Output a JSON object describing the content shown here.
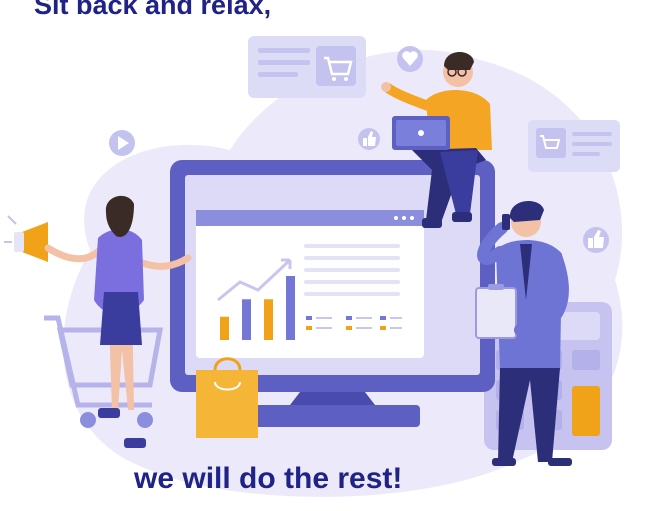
{
  "headline_top": "Sit back and relax,",
  "headline_bottom": "we will do the rest!",
  "colors": {
    "headline": "#1f2287",
    "blob": "#eceafa",
    "monitor": "#5d5fc3",
    "accent_orange": "#f0a318",
    "bar_purple": "#7477d6",
    "man_shirt_blue": "#6e74d4",
    "sitting_man_shirt": "#f5a524",
    "woman_dress": "#7b6fe0"
  },
  "icons": [
    "megaphone-icon",
    "shopping-cart-icon",
    "heart-icon",
    "thumbs-up-icon",
    "play-icon",
    "calculator-icon",
    "shopping-bag-icon",
    "phone-icon",
    "laptop-icon",
    "clipboard-icon"
  ],
  "chart_data": {
    "type": "bar",
    "categories": [
      "1",
      "2",
      "3",
      "4"
    ],
    "values": [
      2,
      3.5,
      3.5,
      5.5
    ],
    "colors": [
      "#f0a318",
      "#7477d6",
      "#f0a318",
      "#7477d6"
    ],
    "trend": "rising",
    "title": "",
    "xlabel": "",
    "ylabel": ""
  }
}
